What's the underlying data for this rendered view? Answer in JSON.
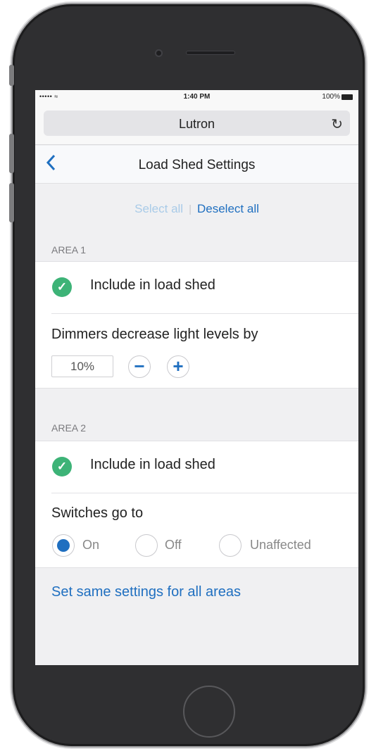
{
  "status_bar": {
    "signal": "••••• ≈",
    "time": "1:40 PM",
    "battery": "100%"
  },
  "browser": {
    "url": "Lutron",
    "reload_icon": "reload-icon"
  },
  "nav": {
    "back_icon": "chevron-left-icon",
    "title": "Load Shed Settings"
  },
  "select_bar": {
    "select_all": "Select all",
    "divider": "|",
    "deselect_all": "Deselect all"
  },
  "areas": [
    {
      "header": "AREA 1",
      "include_label": "Include in load shed",
      "included": true,
      "setting_label": "Dimmers decrease light levels by",
      "decrease_value": "10%",
      "minus": "−",
      "plus": "+"
    },
    {
      "header": "AREA 2",
      "include_label": "Include in load shed",
      "included": true,
      "setting_label": "Switches go to",
      "options": [
        {
          "label": "On",
          "selected": true
        },
        {
          "label": "Off",
          "selected": false
        },
        {
          "label": "Unaffected",
          "selected": false
        }
      ]
    }
  ],
  "footer_link": "Set same settings for all areas",
  "colors": {
    "accent": "#1f6fc0",
    "check": "#3db377",
    "muted_link": "#a9cbe8"
  }
}
